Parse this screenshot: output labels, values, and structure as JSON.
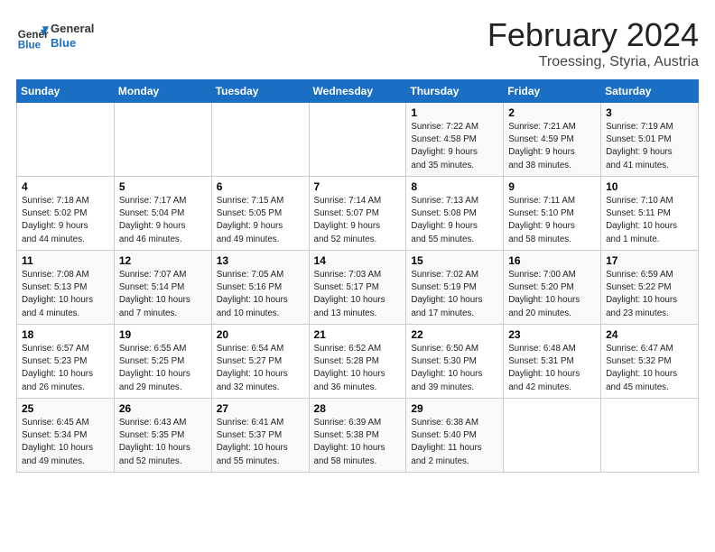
{
  "header": {
    "logo_line1": "General",
    "logo_line2": "Blue",
    "month": "February 2024",
    "location": "Troessing, Styria, Austria"
  },
  "weekdays": [
    "Sunday",
    "Monday",
    "Tuesday",
    "Wednesday",
    "Thursday",
    "Friday",
    "Saturday"
  ],
  "weeks": [
    [
      {
        "day": "",
        "info": ""
      },
      {
        "day": "",
        "info": ""
      },
      {
        "day": "",
        "info": ""
      },
      {
        "day": "",
        "info": ""
      },
      {
        "day": "1",
        "info": "Sunrise: 7:22 AM\nSunset: 4:58 PM\nDaylight: 9 hours\nand 35 minutes."
      },
      {
        "day": "2",
        "info": "Sunrise: 7:21 AM\nSunset: 4:59 PM\nDaylight: 9 hours\nand 38 minutes."
      },
      {
        "day": "3",
        "info": "Sunrise: 7:19 AM\nSunset: 5:01 PM\nDaylight: 9 hours\nand 41 minutes."
      }
    ],
    [
      {
        "day": "4",
        "info": "Sunrise: 7:18 AM\nSunset: 5:02 PM\nDaylight: 9 hours\nand 44 minutes."
      },
      {
        "day": "5",
        "info": "Sunrise: 7:17 AM\nSunset: 5:04 PM\nDaylight: 9 hours\nand 46 minutes."
      },
      {
        "day": "6",
        "info": "Sunrise: 7:15 AM\nSunset: 5:05 PM\nDaylight: 9 hours\nand 49 minutes."
      },
      {
        "day": "7",
        "info": "Sunrise: 7:14 AM\nSunset: 5:07 PM\nDaylight: 9 hours\nand 52 minutes."
      },
      {
        "day": "8",
        "info": "Sunrise: 7:13 AM\nSunset: 5:08 PM\nDaylight: 9 hours\nand 55 minutes."
      },
      {
        "day": "9",
        "info": "Sunrise: 7:11 AM\nSunset: 5:10 PM\nDaylight: 9 hours\nand 58 minutes."
      },
      {
        "day": "10",
        "info": "Sunrise: 7:10 AM\nSunset: 5:11 PM\nDaylight: 10 hours\nand 1 minute."
      }
    ],
    [
      {
        "day": "11",
        "info": "Sunrise: 7:08 AM\nSunset: 5:13 PM\nDaylight: 10 hours\nand 4 minutes."
      },
      {
        "day": "12",
        "info": "Sunrise: 7:07 AM\nSunset: 5:14 PM\nDaylight: 10 hours\nand 7 minutes."
      },
      {
        "day": "13",
        "info": "Sunrise: 7:05 AM\nSunset: 5:16 PM\nDaylight: 10 hours\nand 10 minutes."
      },
      {
        "day": "14",
        "info": "Sunrise: 7:03 AM\nSunset: 5:17 PM\nDaylight: 10 hours\nand 13 minutes."
      },
      {
        "day": "15",
        "info": "Sunrise: 7:02 AM\nSunset: 5:19 PM\nDaylight: 10 hours\nand 17 minutes."
      },
      {
        "day": "16",
        "info": "Sunrise: 7:00 AM\nSunset: 5:20 PM\nDaylight: 10 hours\nand 20 minutes."
      },
      {
        "day": "17",
        "info": "Sunrise: 6:59 AM\nSunset: 5:22 PM\nDaylight: 10 hours\nand 23 minutes."
      }
    ],
    [
      {
        "day": "18",
        "info": "Sunrise: 6:57 AM\nSunset: 5:23 PM\nDaylight: 10 hours\nand 26 minutes."
      },
      {
        "day": "19",
        "info": "Sunrise: 6:55 AM\nSunset: 5:25 PM\nDaylight: 10 hours\nand 29 minutes."
      },
      {
        "day": "20",
        "info": "Sunrise: 6:54 AM\nSunset: 5:27 PM\nDaylight: 10 hours\nand 32 minutes."
      },
      {
        "day": "21",
        "info": "Sunrise: 6:52 AM\nSunset: 5:28 PM\nDaylight: 10 hours\nand 36 minutes."
      },
      {
        "day": "22",
        "info": "Sunrise: 6:50 AM\nSunset: 5:30 PM\nDaylight: 10 hours\nand 39 minutes."
      },
      {
        "day": "23",
        "info": "Sunrise: 6:48 AM\nSunset: 5:31 PM\nDaylight: 10 hours\nand 42 minutes."
      },
      {
        "day": "24",
        "info": "Sunrise: 6:47 AM\nSunset: 5:32 PM\nDaylight: 10 hours\nand 45 minutes."
      }
    ],
    [
      {
        "day": "25",
        "info": "Sunrise: 6:45 AM\nSunset: 5:34 PM\nDaylight: 10 hours\nand 49 minutes."
      },
      {
        "day": "26",
        "info": "Sunrise: 6:43 AM\nSunset: 5:35 PM\nDaylight: 10 hours\nand 52 minutes."
      },
      {
        "day": "27",
        "info": "Sunrise: 6:41 AM\nSunset: 5:37 PM\nDaylight: 10 hours\nand 55 minutes."
      },
      {
        "day": "28",
        "info": "Sunrise: 6:39 AM\nSunset: 5:38 PM\nDaylight: 10 hours\nand 58 minutes."
      },
      {
        "day": "29",
        "info": "Sunrise: 6:38 AM\nSunset: 5:40 PM\nDaylight: 11 hours\nand 2 minutes."
      },
      {
        "day": "",
        "info": ""
      },
      {
        "day": "",
        "info": ""
      }
    ]
  ]
}
